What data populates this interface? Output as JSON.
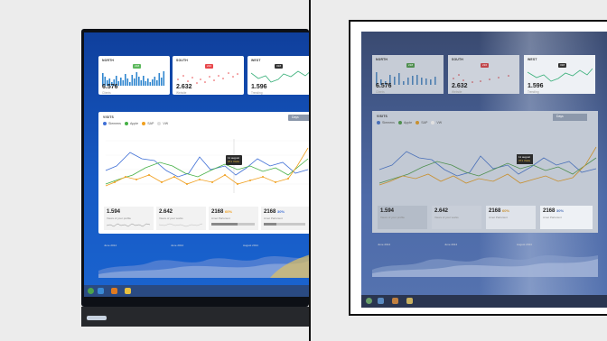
{
  "left_dashboard": {
    "cards": [
      {
        "title": "NORTH",
        "value": "6.576",
        "subtitle": "Clients",
        "badge": "218",
        "badge_color": "#5cb85c"
      },
      {
        "title": "SOUTH",
        "value": "2.632",
        "subtitle": "Website",
        "badge": "216",
        "badge_color": "#e8474b"
      },
      {
        "title": "WEST",
        "value": "1.596",
        "subtitle": "Trending",
        "badge": "318",
        "badge_color": "#333333"
      }
    ],
    "visits": {
      "title": "VISITS",
      "legend": [
        {
          "name": "Siemens",
          "color": "#3f6fd6"
        },
        {
          "name": "Apple",
          "color": "#45b045"
        },
        {
          "name": "SAP",
          "color": "#f0a020"
        },
        {
          "name": "VW",
          "color": "#dddddd"
        }
      ],
      "dropdown": "Days",
      "tooltip": {
        "line1": "11 august",
        "line2": "371 Visits"
      }
    },
    "stats": [
      {
        "value": "1.594",
        "label": "Views of your profile",
        "pct": ""
      },
      {
        "value": "2.642",
        "label": "Views of your works",
        "pct": ""
      },
      {
        "value": "2168",
        "pct": "60%",
        "label": "Amet Parturient",
        "fill": 0.6
      },
      {
        "value": "2168",
        "pct": "30%",
        "label": "Amet Parturient",
        "fill": 0.3
      }
    ],
    "timeline": [
      "June 2014",
      "June 2014",
      "August 2014"
    ]
  },
  "right_dashboard": {
    "cards": [
      {
        "title": "NORTH",
        "value": "6.576",
        "subtitle": "Clients",
        "badge": "218"
      },
      {
        "title": "SOUTH",
        "value": "2.632",
        "subtitle": "Website",
        "badge": "216"
      },
      {
        "title": "WEST",
        "value": "1.596",
        "subtitle": "Trending",
        "badge": "318"
      }
    ],
    "visits_title": "VISITS",
    "legend": [
      "Siemens",
      "Apple",
      "SAP",
      "VW"
    ],
    "dropdown": "Days",
    "tooltip": {
      "line1": "11 august",
      "line2": "371 Visits"
    },
    "stats": [
      {
        "value": "1.594",
        "label": "Views of your profile"
      },
      {
        "value": "2.642",
        "label": "Views of your works"
      },
      {
        "value": "2168",
        "pct": "60%",
        "label": "Amet Parturient"
      },
      {
        "value": "2168",
        "pct": "30%",
        "label": "Amet Parturient"
      }
    ],
    "timeline": [
      "June 2014",
      "June 2014",
      "August 2014"
    ]
  }
}
